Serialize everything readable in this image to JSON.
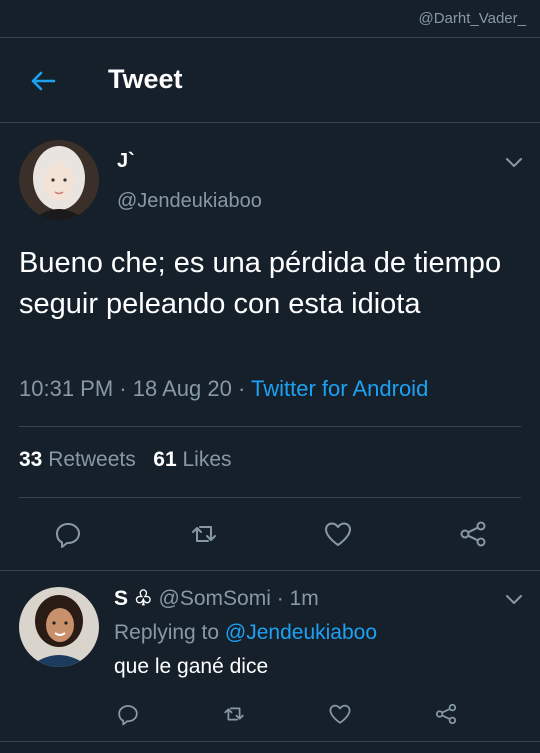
{
  "watermark": "@Darht_Vader_",
  "header": {
    "title": "Tweet"
  },
  "main_tweet": {
    "name": "J`",
    "handle": "@Jendeukiaboo",
    "text": "Bueno che; es una pérdida de tiempo seguir peleando con esta idiota",
    "time": "10:31 PM",
    "date": "18 Aug 20",
    "source": "Twitter for Android",
    "retweets_count": "33",
    "retweets_label": "Retweets",
    "likes_count": "61",
    "likes_label": "Likes"
  },
  "reply": {
    "name": "S ♧",
    "handle": "@SomSomi",
    "time": "1m",
    "replying_prefix": "Replying to",
    "replying_handle": "@Jendeukiaboo",
    "text": "que le gané dice"
  },
  "icons": [
    "back-arrow-icon",
    "chevron-down-icon",
    "reply-icon",
    "retweet-icon",
    "like-icon",
    "share-icon"
  ],
  "colors": {
    "background": "#15202b",
    "accent": "#1da1f2",
    "muted": "#8899a6",
    "divider": "#38444d"
  }
}
